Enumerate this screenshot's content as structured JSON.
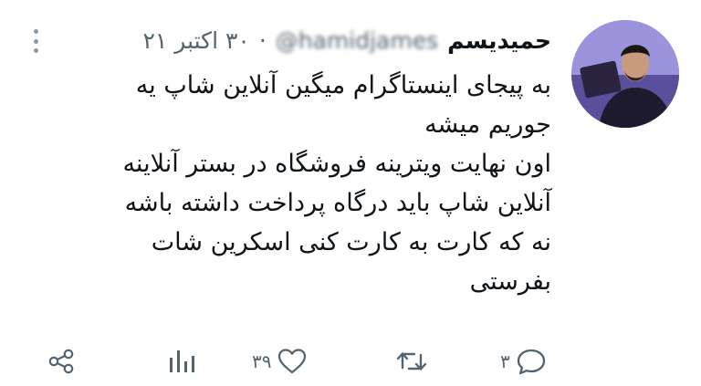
{
  "tweet": {
    "author_name": "حمیدیسم",
    "handle": "@hamidjames",
    "separator": "·",
    "date": "۳۰ اکتبر ۲۱",
    "body_lines": [
      "به پیجای اینستاگرام میگین آنلاین شاپ یه",
      "جوریم میشه",
      "اون نهایت ویترینه فروشگاه در بستر آنلاینه",
      "آنلاین شاپ باید درگاه پرداخت داشته باشه",
      "نه که کارت به کارت کنی اسکرین شات",
      "بفرستی"
    ]
  },
  "actions": {
    "share_icon": "share-icon",
    "analytics_icon": "analytics-icon",
    "like_icon": "heart-icon",
    "like_count": "۳۹",
    "retweet_icon": "retweet-icon",
    "reply_icon": "reply-icon",
    "reply_count": "۳"
  },
  "colors": {
    "text": "#0f1419",
    "secondary": "#536471",
    "icon": "#536471"
  }
}
